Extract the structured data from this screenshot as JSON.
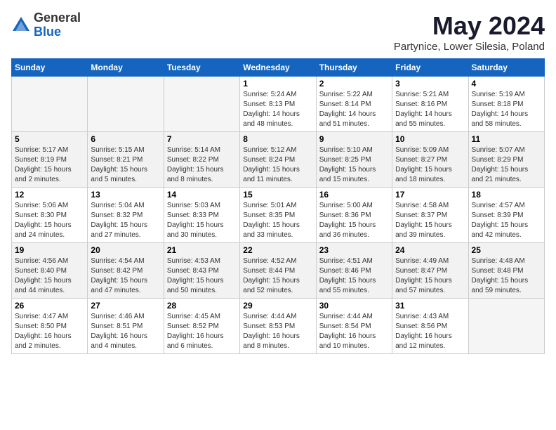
{
  "header": {
    "logo_general": "General",
    "logo_blue": "Blue",
    "month_title": "May 2024",
    "location": "Partynice, Lower Silesia, Poland"
  },
  "weekdays": [
    "Sunday",
    "Monday",
    "Tuesday",
    "Wednesday",
    "Thursday",
    "Friday",
    "Saturday"
  ],
  "weeks": [
    [
      {
        "day": null,
        "info": null
      },
      {
        "day": null,
        "info": null
      },
      {
        "day": null,
        "info": null
      },
      {
        "day": "1",
        "sunrise": "Sunrise: 5:24 AM",
        "sunset": "Sunset: 8:13 PM",
        "daylight": "Daylight: 14 hours and 48 minutes."
      },
      {
        "day": "2",
        "sunrise": "Sunrise: 5:22 AM",
        "sunset": "Sunset: 8:14 PM",
        "daylight": "Daylight: 14 hours and 51 minutes."
      },
      {
        "day": "3",
        "sunrise": "Sunrise: 5:21 AM",
        "sunset": "Sunset: 8:16 PM",
        "daylight": "Daylight: 14 hours and 55 minutes."
      },
      {
        "day": "4",
        "sunrise": "Sunrise: 5:19 AM",
        "sunset": "Sunset: 8:18 PM",
        "daylight": "Daylight: 14 hours and 58 minutes."
      }
    ],
    [
      {
        "day": "5",
        "sunrise": "Sunrise: 5:17 AM",
        "sunset": "Sunset: 8:19 PM",
        "daylight": "Daylight: 15 hours and 2 minutes."
      },
      {
        "day": "6",
        "sunrise": "Sunrise: 5:15 AM",
        "sunset": "Sunset: 8:21 PM",
        "daylight": "Daylight: 15 hours and 5 minutes."
      },
      {
        "day": "7",
        "sunrise": "Sunrise: 5:14 AM",
        "sunset": "Sunset: 8:22 PM",
        "daylight": "Daylight: 15 hours and 8 minutes."
      },
      {
        "day": "8",
        "sunrise": "Sunrise: 5:12 AM",
        "sunset": "Sunset: 8:24 PM",
        "daylight": "Daylight: 15 hours and 11 minutes."
      },
      {
        "day": "9",
        "sunrise": "Sunrise: 5:10 AM",
        "sunset": "Sunset: 8:25 PM",
        "daylight": "Daylight: 15 hours and 15 minutes."
      },
      {
        "day": "10",
        "sunrise": "Sunrise: 5:09 AM",
        "sunset": "Sunset: 8:27 PM",
        "daylight": "Daylight: 15 hours and 18 minutes."
      },
      {
        "day": "11",
        "sunrise": "Sunrise: 5:07 AM",
        "sunset": "Sunset: 8:29 PM",
        "daylight": "Daylight: 15 hours and 21 minutes."
      }
    ],
    [
      {
        "day": "12",
        "sunrise": "Sunrise: 5:06 AM",
        "sunset": "Sunset: 8:30 PM",
        "daylight": "Daylight: 15 hours and 24 minutes."
      },
      {
        "day": "13",
        "sunrise": "Sunrise: 5:04 AM",
        "sunset": "Sunset: 8:32 PM",
        "daylight": "Daylight: 15 hours and 27 minutes."
      },
      {
        "day": "14",
        "sunrise": "Sunrise: 5:03 AM",
        "sunset": "Sunset: 8:33 PM",
        "daylight": "Daylight: 15 hours and 30 minutes."
      },
      {
        "day": "15",
        "sunrise": "Sunrise: 5:01 AM",
        "sunset": "Sunset: 8:35 PM",
        "daylight": "Daylight: 15 hours and 33 minutes."
      },
      {
        "day": "16",
        "sunrise": "Sunrise: 5:00 AM",
        "sunset": "Sunset: 8:36 PM",
        "daylight": "Daylight: 15 hours and 36 minutes."
      },
      {
        "day": "17",
        "sunrise": "Sunrise: 4:58 AM",
        "sunset": "Sunset: 8:37 PM",
        "daylight": "Daylight: 15 hours and 39 minutes."
      },
      {
        "day": "18",
        "sunrise": "Sunrise: 4:57 AM",
        "sunset": "Sunset: 8:39 PM",
        "daylight": "Daylight: 15 hours and 42 minutes."
      }
    ],
    [
      {
        "day": "19",
        "sunrise": "Sunrise: 4:56 AM",
        "sunset": "Sunset: 8:40 PM",
        "daylight": "Daylight: 15 hours and 44 minutes."
      },
      {
        "day": "20",
        "sunrise": "Sunrise: 4:54 AM",
        "sunset": "Sunset: 8:42 PM",
        "daylight": "Daylight: 15 hours and 47 minutes."
      },
      {
        "day": "21",
        "sunrise": "Sunrise: 4:53 AM",
        "sunset": "Sunset: 8:43 PM",
        "daylight": "Daylight: 15 hours and 50 minutes."
      },
      {
        "day": "22",
        "sunrise": "Sunrise: 4:52 AM",
        "sunset": "Sunset: 8:44 PM",
        "daylight": "Daylight: 15 hours and 52 minutes."
      },
      {
        "day": "23",
        "sunrise": "Sunrise: 4:51 AM",
        "sunset": "Sunset: 8:46 PM",
        "daylight": "Daylight: 15 hours and 55 minutes."
      },
      {
        "day": "24",
        "sunrise": "Sunrise: 4:49 AM",
        "sunset": "Sunset: 8:47 PM",
        "daylight": "Daylight: 15 hours and 57 minutes."
      },
      {
        "day": "25",
        "sunrise": "Sunrise: 4:48 AM",
        "sunset": "Sunset: 8:48 PM",
        "daylight": "Daylight: 15 hours and 59 minutes."
      }
    ],
    [
      {
        "day": "26",
        "sunrise": "Sunrise: 4:47 AM",
        "sunset": "Sunset: 8:50 PM",
        "daylight": "Daylight: 16 hours and 2 minutes."
      },
      {
        "day": "27",
        "sunrise": "Sunrise: 4:46 AM",
        "sunset": "Sunset: 8:51 PM",
        "daylight": "Daylight: 16 hours and 4 minutes."
      },
      {
        "day": "28",
        "sunrise": "Sunrise: 4:45 AM",
        "sunset": "Sunset: 8:52 PM",
        "daylight": "Daylight: 16 hours and 6 minutes."
      },
      {
        "day": "29",
        "sunrise": "Sunrise: 4:44 AM",
        "sunset": "Sunset: 8:53 PM",
        "daylight": "Daylight: 16 hours and 8 minutes."
      },
      {
        "day": "30",
        "sunrise": "Sunrise: 4:44 AM",
        "sunset": "Sunset: 8:54 PM",
        "daylight": "Daylight: 16 hours and 10 minutes."
      },
      {
        "day": "31",
        "sunrise": "Sunrise: 4:43 AM",
        "sunset": "Sunset: 8:56 PM",
        "daylight": "Daylight: 16 hours and 12 minutes."
      },
      {
        "day": null,
        "info": null
      }
    ]
  ]
}
